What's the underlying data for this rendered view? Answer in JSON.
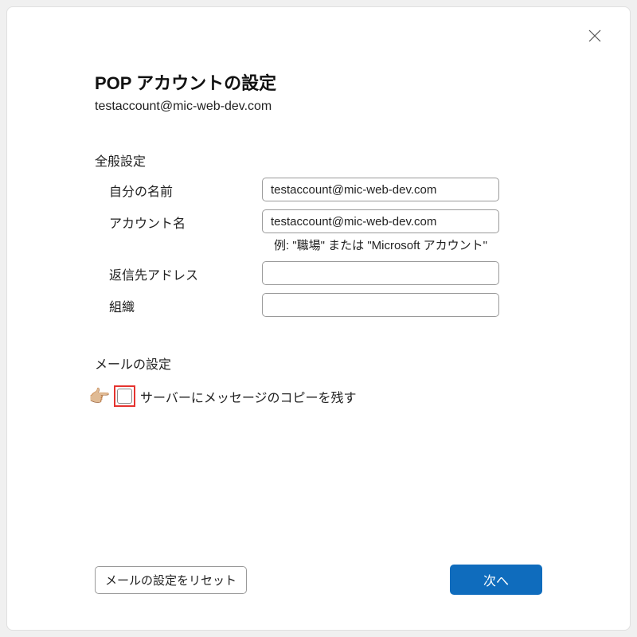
{
  "header": {
    "title": "POP アカウントの設定",
    "email": "testaccount@mic-web-dev.com"
  },
  "general": {
    "section": "全般設定",
    "displayName": {
      "label": "自分の名前",
      "value": "testaccount@mic-web-dev.com"
    },
    "accountName": {
      "label": "アカウント名",
      "value": "testaccount@mic-web-dev.com",
      "hint": "例: \"職場\" または \"Microsoft アカウント\""
    },
    "replyTo": {
      "label": "返信先アドレス",
      "value": ""
    },
    "organization": {
      "label": "組織",
      "value": ""
    }
  },
  "mail": {
    "section": "メールの設定",
    "leaveCopy": {
      "label": "サーバーにメッセージのコピーを残す",
      "checked": false
    }
  },
  "footer": {
    "reset": "メールの設定をリセット",
    "next": "次へ"
  }
}
